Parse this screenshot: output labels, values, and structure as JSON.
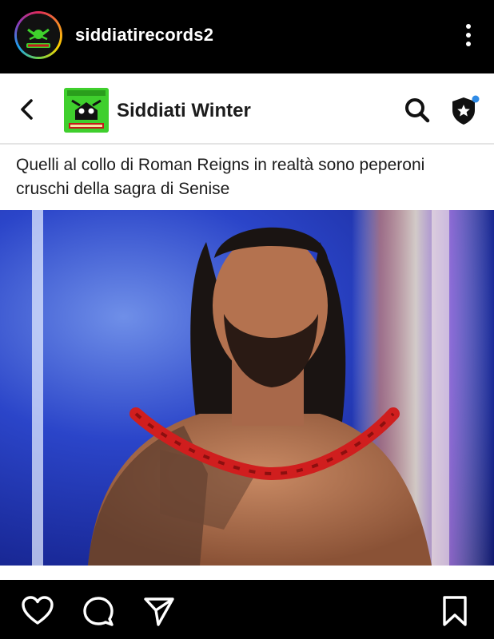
{
  "header": {
    "username": "siddiatirecords2",
    "avatar_icon": "logo-avatar",
    "more_icon": "more-vertical-icon"
  },
  "post_card": {
    "page_title": "Siddiati Winter",
    "back_icon": "chevron-left-icon",
    "search_icon": "search-icon",
    "shield_icon": "shield-star-icon",
    "notification_dot_color": "#2f8be6",
    "caption": "Quelli al collo di Roman Reigns in realtà sono peperoni cruschi della sagra di Senise"
  },
  "actions": {
    "like_icon": "heart-icon",
    "comment_icon": "comment-icon",
    "share_icon": "send-icon",
    "save_icon": "bookmark-icon"
  },
  "colors": {
    "background": "#000000",
    "card": "#ffffff",
    "logo_green": "#3fcf2d"
  }
}
